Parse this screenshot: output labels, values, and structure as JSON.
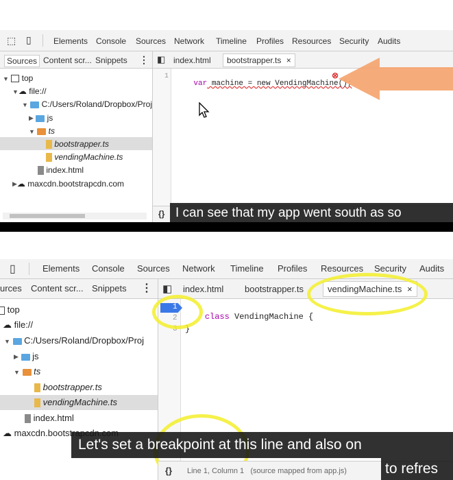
{
  "top": {
    "toolbar_items": [
      "Elements",
      "Console",
      "Sources",
      "Network",
      "Timeline",
      "Profiles",
      "Resources",
      "Security",
      "Audits"
    ],
    "nav_tabs": [
      "Sources",
      "Content scr...",
      "Snippets"
    ],
    "nav_more": "⋮",
    "editor_tabs": [
      "index.html",
      "bootstrapper.ts"
    ],
    "close_glyph": "×",
    "tree": {
      "top": "top",
      "file": "file://",
      "path": "C:/Users/Roland/Dropbox/Proj",
      "js": "js",
      "ts": "ts",
      "bootstrapper": "bootstrapper.ts",
      "vending": "vendingMachine.ts",
      "index": "index.html",
      "cdn": "maxcdn.bootstrapcdn.com"
    },
    "line_number": "1",
    "code_kw": "var",
    "code_rest": " machine = new VendingMachine();",
    "error_glyph": "⊗",
    "bottom_braces": "{}",
    "caption": "I can see that my app went south as so"
  },
  "bottom": {
    "toolbar_items": [
      "Elements",
      "Console",
      "Sources",
      "Network",
      "Timeline",
      "Profiles",
      "Resources",
      "Security",
      "Audits"
    ],
    "nav_tabs": [
      "urces",
      "Content scr...",
      "Snippets"
    ],
    "nav_more": "⋮",
    "editor_tabs": [
      "index.html",
      "bootstrapper.ts",
      "vendingMachine.ts"
    ],
    "close_glyph": "×",
    "tree": {
      "top": "top",
      "file": "file://",
      "path": "C:/Users/Roland/Dropbox/Proj",
      "js": "js",
      "ts": "ts",
      "bootstrapper": "bootstrapper.ts",
      "vending": "vendingMachine.ts",
      "index": "index.html",
      "cdn": "maxcdn.bootstrapcdn.com"
    },
    "line_numbers": [
      "1",
      "2",
      "3"
    ],
    "code_kw": "class",
    "code_line1_rest": " VendingMachine {",
    "code_line3": "}",
    "bottom_braces": "{}",
    "status_text": "Line 1, Column 1   (source mapped from app.js)",
    "caption_line1": "Let's set a breakpoint at this line and also on",
    "caption_line2": "to refres"
  },
  "colors": {
    "arrow": "#f5a36c",
    "highlight": "#f3ee2a",
    "selected_row": "#dddddd",
    "breakpoint": "#3b78e7"
  }
}
